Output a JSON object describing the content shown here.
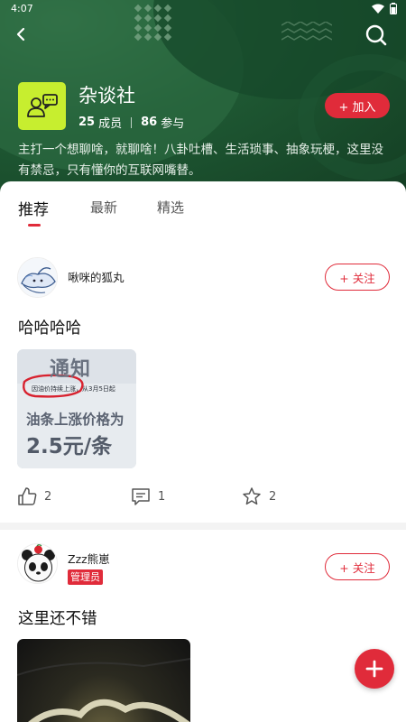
{
  "status_bar": {
    "time": "4:07"
  },
  "group": {
    "name": "杂谈社",
    "members_count": "25",
    "members_label": "成员",
    "participants_count": "86",
    "participants_label": "参与",
    "join_label": "+ 加入",
    "description": "主打一个想聊啥，就聊啥！八卦吐槽、生活琐事、抽象玩梗，这里没有禁忌，只有懂你的互联网嘴替。"
  },
  "tabs": [
    {
      "label": "推荐",
      "active": true
    },
    {
      "label": "最新",
      "active": false
    },
    {
      "label": "精选",
      "active": false
    }
  ],
  "posts": [
    {
      "author": "啾咪的狐丸",
      "follow_label": "+ 关注",
      "title": "哈哈哈哈",
      "image": {
        "heading": "通知",
        "notice": "因油价持续上涨，从3月5日起",
        "line1": "油条上涨价格为",
        "line2": "2.5元/条"
      },
      "likes": "2",
      "comments": "1",
      "favorites": "2"
    },
    {
      "author": "Zzz熊崽",
      "badge": "管理员",
      "follow_label": "+ 关注",
      "title": "这里还不错"
    }
  ],
  "icons": {
    "back": "back-arrow-icon",
    "search": "search-icon",
    "like": "thumbs-up-icon",
    "comment": "comment-icon",
    "favorite": "star-icon",
    "fab": "plus-icon"
  },
  "colors": {
    "accent": "#e02b3a",
    "header_green": "#1f5a34",
    "avatar_lime": "#c7ee2f"
  }
}
